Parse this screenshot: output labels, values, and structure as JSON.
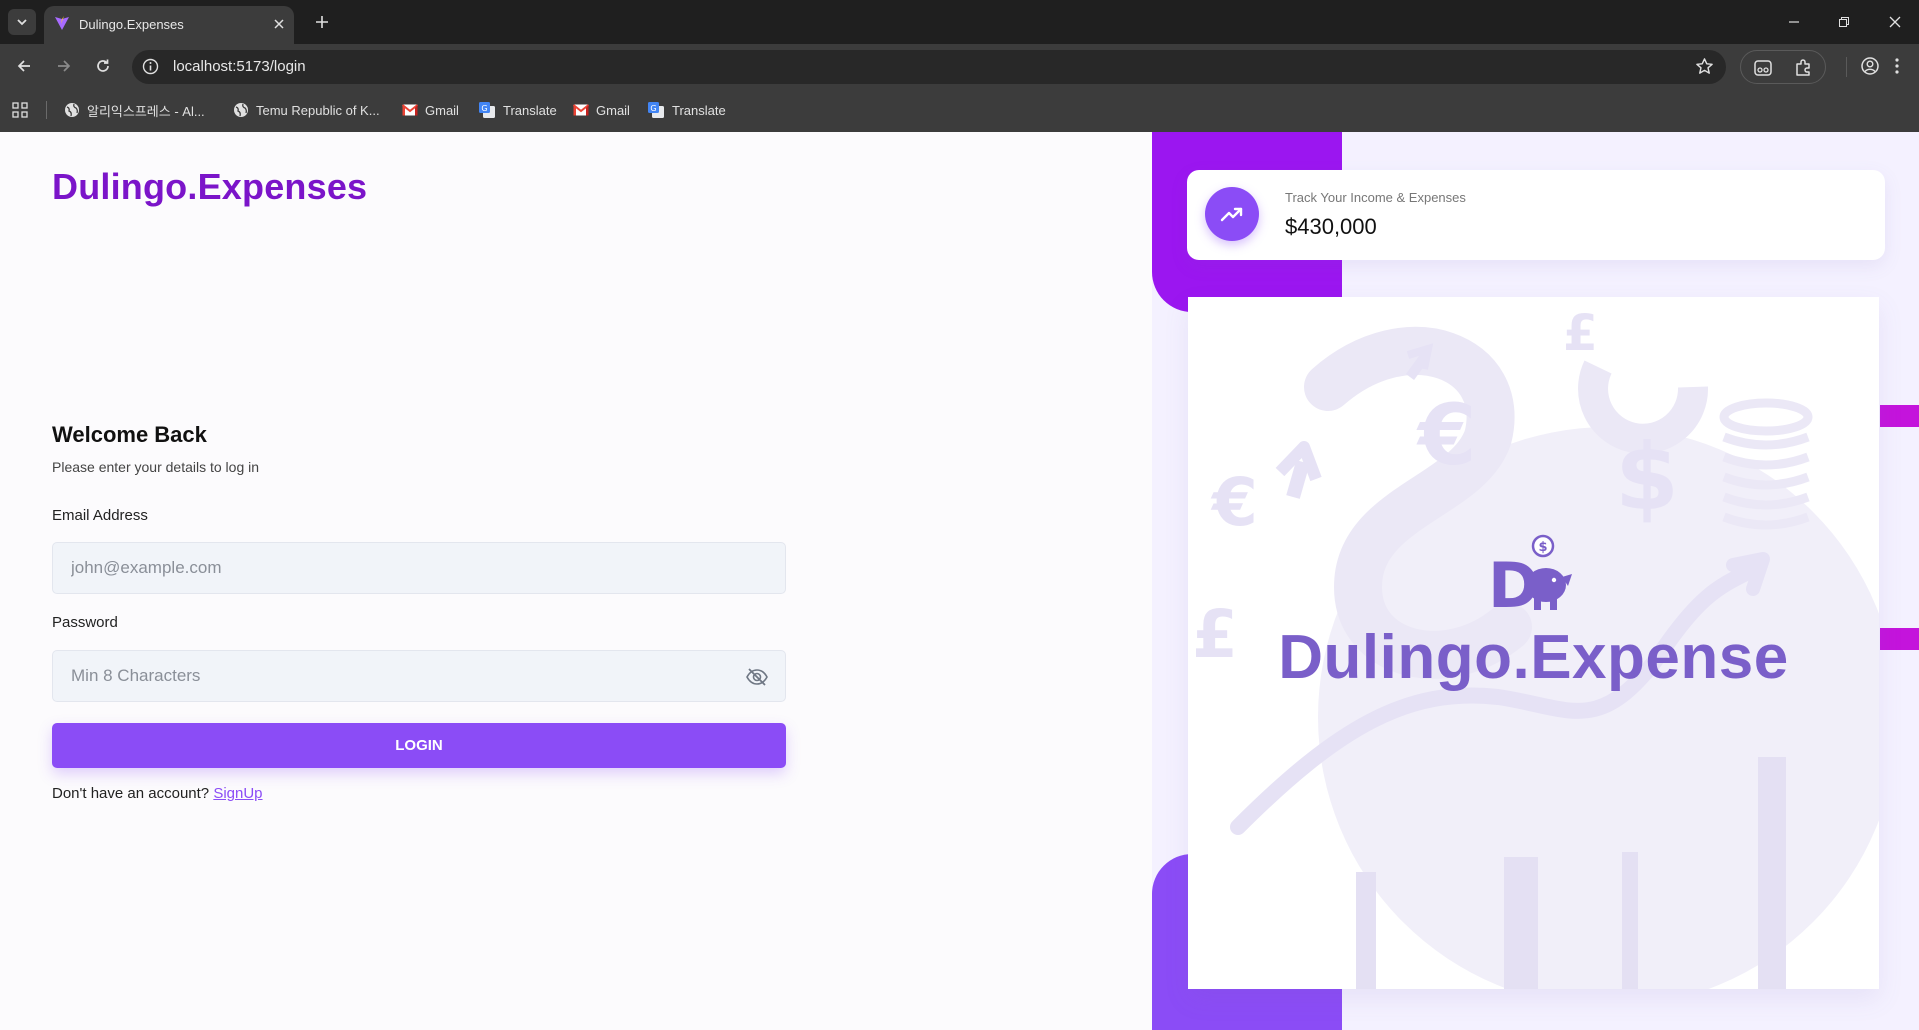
{
  "browser": {
    "tab_title": "Dulingo.Expenses",
    "url": "localhost:5173/login",
    "bookmarks": [
      {
        "label": "알리익스프레스 - Al...",
        "icon": "globe-icon"
      },
      {
        "label": "Temu Republic of K...",
        "icon": "globe-icon"
      },
      {
        "label": "Gmail",
        "icon": "gmail-icon"
      },
      {
        "label": "Translate",
        "icon": "translate-icon"
      },
      {
        "label": "Gmail",
        "icon": "gmail-icon"
      },
      {
        "label": "Translate",
        "icon": "translate-icon"
      }
    ]
  },
  "brand": {
    "name": "Dulingo.Expenses",
    "color": "#7b14c9"
  },
  "login": {
    "heading": "Welcome Back",
    "subtitle": "Please enter your details to log in",
    "email_label": "Email Address",
    "email_placeholder": "john@example.com",
    "email_value": "",
    "password_label": "Password",
    "password_placeholder": "Min 8 Characters",
    "password_value": "",
    "login_label": "LOGIN",
    "signup_prompt": "Don't have an account?",
    "signup_link": "SignUp"
  },
  "stat_card": {
    "label": "Track Your Income & Expenses",
    "value": "$430,000",
    "icon": "trending-up-icon"
  },
  "hero": {
    "title": "Dulingo.Expense",
    "logo_letter": "D",
    "currency_glyphs": [
      "$",
      "€",
      "£",
      "€",
      "£",
      "$"
    ]
  },
  "colors": {
    "accent": "#8b4cf6",
    "deco_top": "#9b16f0",
    "deco_stripe": "#c414dc",
    "right_bg": "#f4f1ff"
  }
}
